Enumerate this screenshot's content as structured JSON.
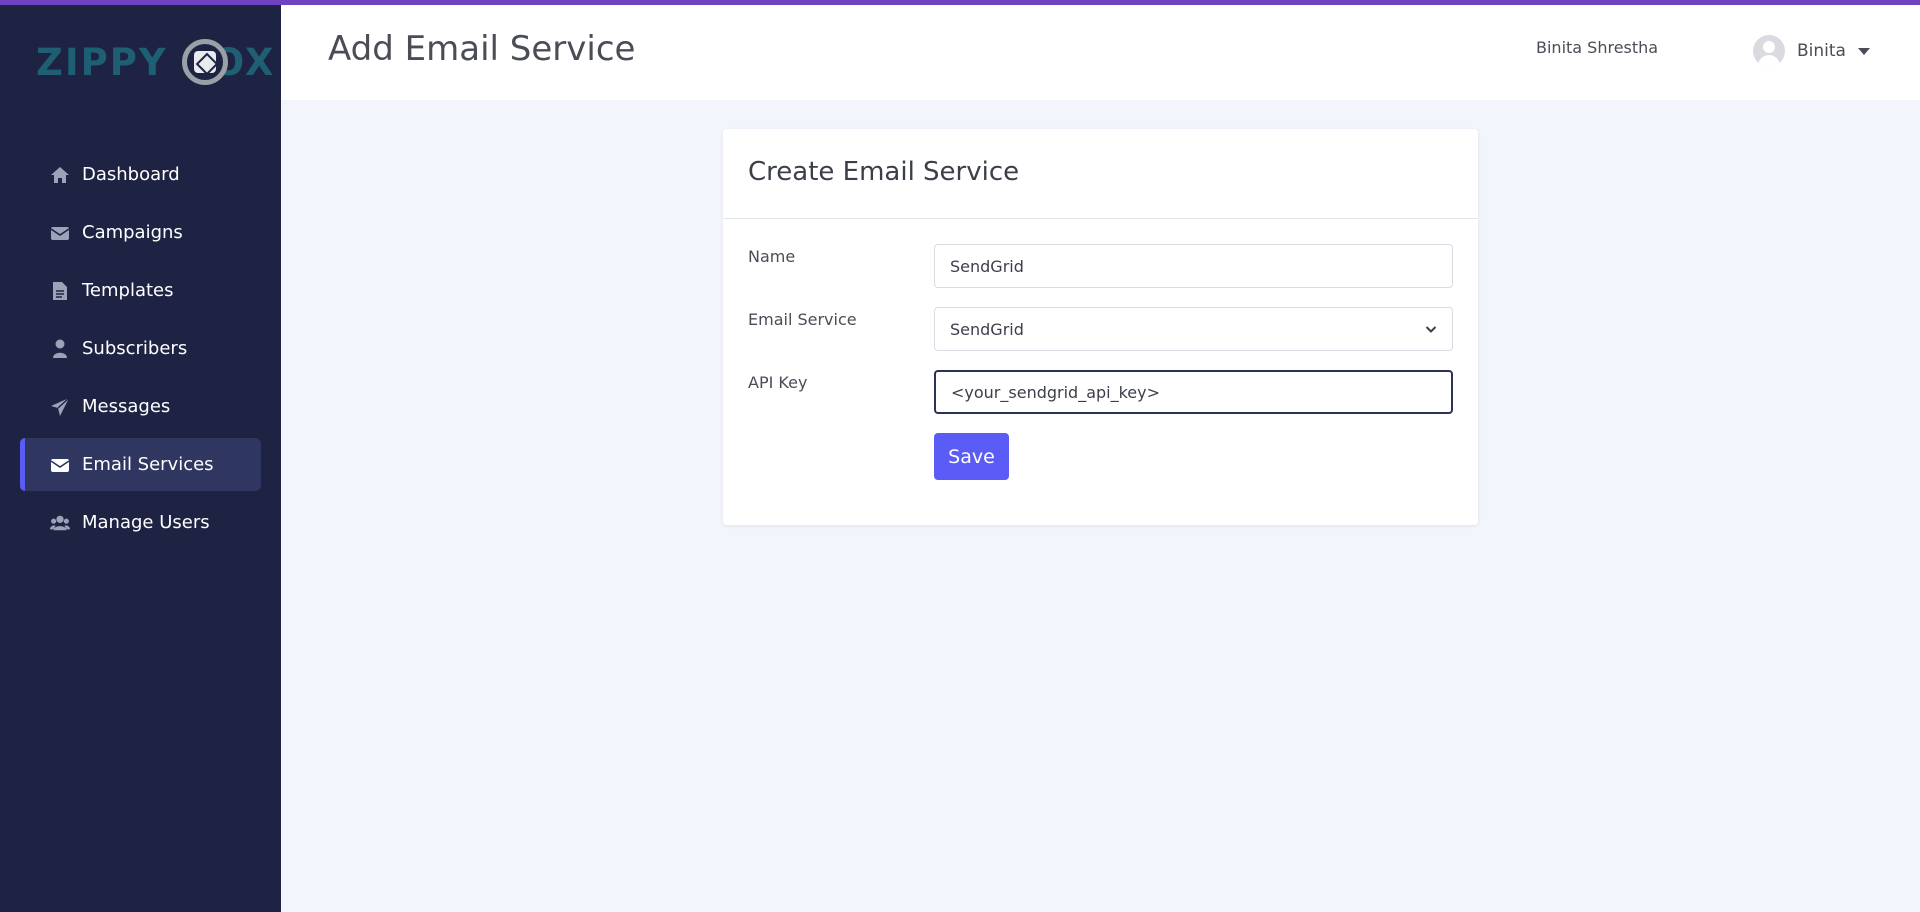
{
  "app": {
    "logo_text": "ZIPPY BOX",
    "accent_color": "#6f42c1",
    "primary_color": "#5b5cf6",
    "sidebar_color": "#1f2343"
  },
  "sidebar": {
    "items": [
      {
        "label": "Dashboard",
        "icon": "home-icon",
        "active": false
      },
      {
        "label": "Campaigns",
        "icon": "envelope-icon",
        "active": false
      },
      {
        "label": "Templates",
        "icon": "file-icon",
        "active": false
      },
      {
        "label": "Subscribers",
        "icon": "user-icon",
        "active": false
      },
      {
        "label": "Messages",
        "icon": "paper-plane-icon",
        "active": false
      },
      {
        "label": "Email Services",
        "icon": "envelope-icon",
        "active": true
      },
      {
        "label": "Manage Users",
        "icon": "users-icon",
        "active": false
      }
    ]
  },
  "header": {
    "title": "Add Email Service",
    "user_fullname": "Binita Shrestha",
    "user_short": "Binita"
  },
  "form": {
    "title": "Create Email Service",
    "name_label": "Name",
    "name_value": "SendGrid",
    "service_label": "Email Service",
    "service_selected": "SendGrid",
    "api_key_label": "API Key",
    "api_key_value": "<your_sendgrid_api_key>",
    "save_label": "Save"
  }
}
